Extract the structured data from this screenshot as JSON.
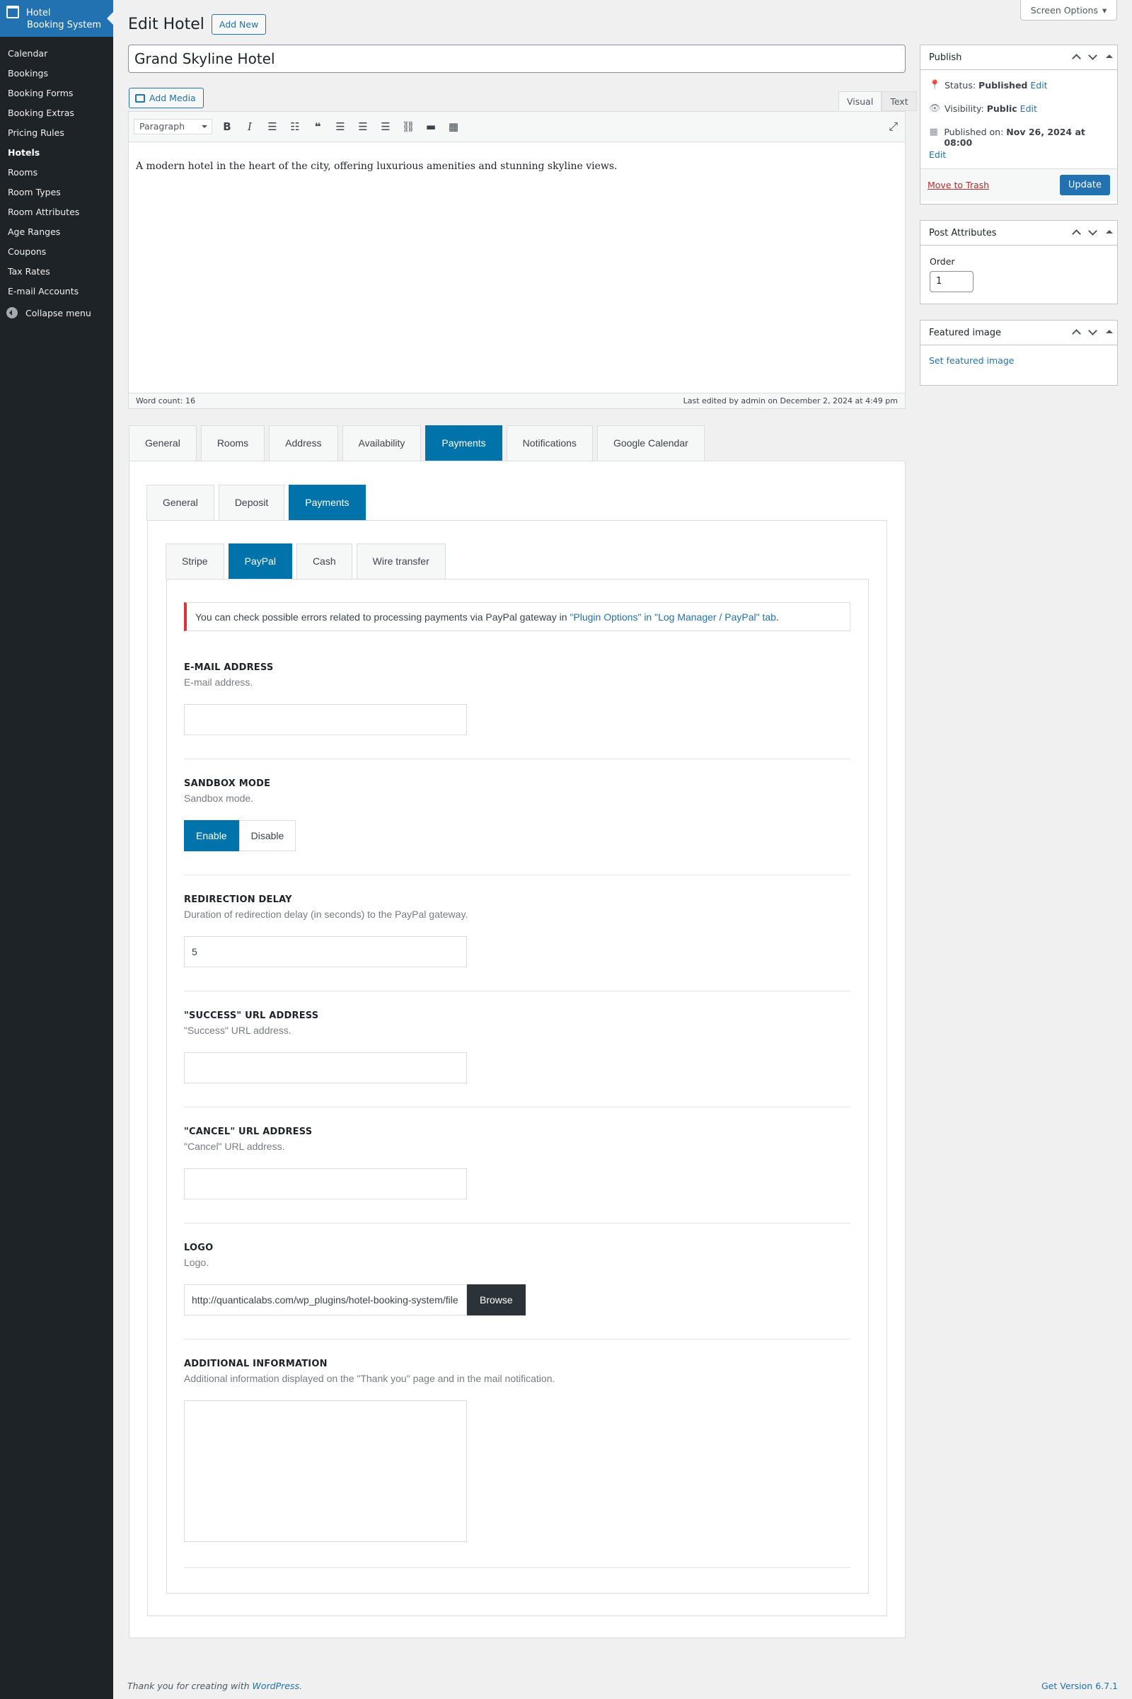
{
  "sidebar": {
    "brand_line1": "Hotel",
    "brand_line2": "Booking System",
    "items": [
      "Calendar",
      "Bookings",
      "Booking Forms",
      "Booking Extras",
      "Pricing Rules",
      "Hotels",
      "Rooms",
      "Room Types",
      "Room Attributes",
      "Age Ranges",
      "Coupons",
      "Tax Rates",
      "E-mail Accounts"
    ],
    "current": "Hotels",
    "collapse": "Collapse menu"
  },
  "header": {
    "screen_options": "Screen Options",
    "title": "Edit Hotel",
    "add_new": "Add New"
  },
  "post": {
    "title": "Grand Skyline Hotel",
    "add_media": "Add Media",
    "tab_visual": "Visual",
    "tab_text": "Text",
    "format": "Paragraph",
    "content": "A modern hotel in the heart of the city, offering luxurious amenities and stunning skyline views.",
    "word_count": "Word count: 16",
    "last_edited": "Last edited by admin on December 2, 2024 at 4:49 pm"
  },
  "tabs": {
    "main": [
      "General",
      "Rooms",
      "Address",
      "Availability",
      "Payments",
      "Notifications",
      "Google Calendar"
    ],
    "sub": [
      "General",
      "Deposit",
      "Payments"
    ],
    "gateways": [
      "Stripe",
      "PayPal",
      "Cash",
      "Wire transfer"
    ]
  },
  "notice": {
    "text": "You can check possible errors related to processing payments via PayPal gateway in ",
    "link": "\"Plugin Options\" in \"Log Manager / PayPal\" tab",
    "end": "."
  },
  "fields": {
    "email": {
      "label": "E-MAIL ADDRESS",
      "desc": "E-mail address.",
      "value": ""
    },
    "sandbox": {
      "label": "SANDBOX MODE",
      "desc": "Sandbox mode.",
      "enable": "Enable",
      "disable": "Disable",
      "selected": "Enable"
    },
    "delay": {
      "label": "REDIRECTION DELAY",
      "desc": "Duration of redirection delay (in seconds) to the PayPal gateway.",
      "value": "5"
    },
    "success": {
      "label": "\"SUCCESS\" URL ADDRESS",
      "desc": "\"Success\" URL address.",
      "value": ""
    },
    "cancel": {
      "label": "\"CANCEL\" URL ADDRESS",
      "desc": "\"Cancel\" URL address.",
      "value": ""
    },
    "logo": {
      "label": "LOGO",
      "desc": "Logo.",
      "value": "http://quanticalabs.com/wp_plugins/hotel-booking-system/file",
      "browse": "Browse"
    },
    "info": {
      "label": "ADDITIONAL INFORMATION",
      "desc": "Additional information displayed on the \"Thank you\" page and in the mail notification.",
      "value": ""
    }
  },
  "publish": {
    "title": "Publish",
    "status_label": "Status: ",
    "status": "Published",
    "visibility_label": "Visibility: ",
    "visibility": "Public",
    "published_label": "Published on: ",
    "published": "Nov 26, 2024 at 08:00",
    "edit": "Edit",
    "trash": "Move to Trash",
    "update": "Update"
  },
  "attributes": {
    "title": "Post Attributes",
    "order_label": "Order",
    "order": "1"
  },
  "featured": {
    "title": "Featured image",
    "link": "Set featured image"
  },
  "footer": {
    "thanks": "Thank you for creating with ",
    "wp": "WordPress",
    "thanks_end": ".",
    "version": "Get Version 6.7.1"
  },
  "colors": {
    "accent": "#0073aa",
    "wp_blue": "#2271b1",
    "sidebar_bg": "#1d2327",
    "notice_red": "#d63638"
  }
}
